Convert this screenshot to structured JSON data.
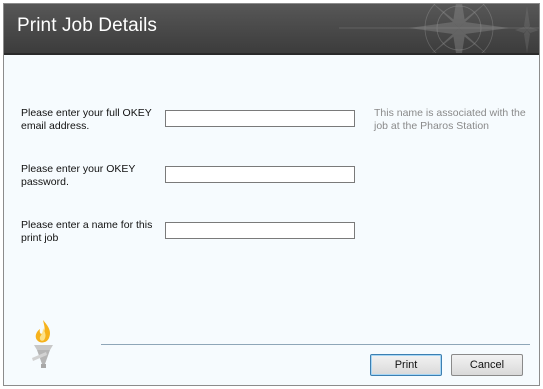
{
  "dialog": {
    "title": "Print Job Details"
  },
  "form": {
    "email_label": "Please enter your full OKEY email address.",
    "email_value": "",
    "email_hint": "This name is associated with the job at the Pharos Station",
    "password_label": "Please enter your OKEY password.",
    "password_value": "",
    "jobname_label": "Please enter a name for this print job",
    "jobname_value": ""
  },
  "buttons": {
    "print_label": "Print",
    "cancel_label": "Cancel"
  },
  "icons": {
    "header_decoration": "compass-rose-icon",
    "logo": "torch-logo-icon"
  },
  "colors": {
    "header_bg": "#4a4a4a",
    "body_bg": "#f6fbfe",
    "flame": "#f6b21c"
  }
}
